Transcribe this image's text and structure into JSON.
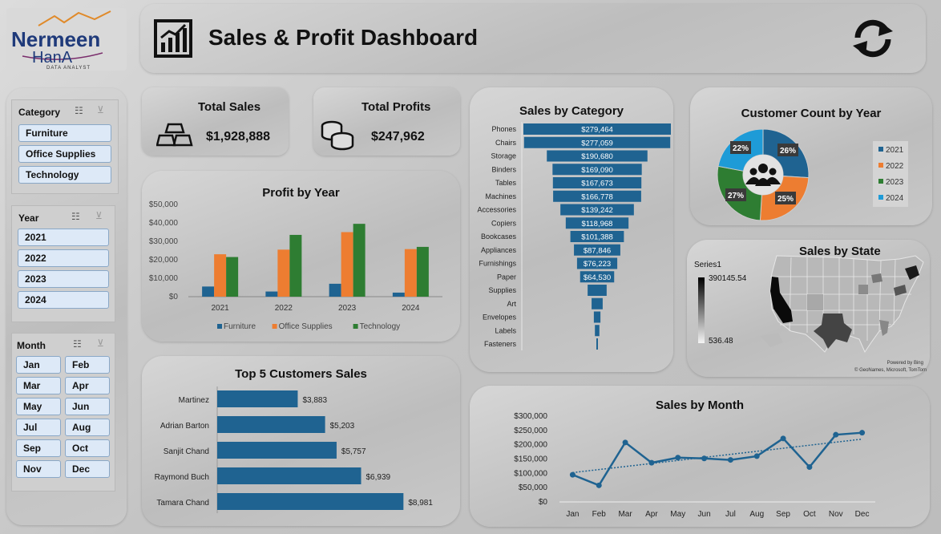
{
  "logo": {
    "name": "Nermeen",
    "name2": "HanA",
    "tagline": "DATA ANALYST"
  },
  "header": {
    "title": "Sales & Profit Dashboard"
  },
  "kpi": {
    "sales_label": "Total Sales",
    "sales_value": "$1,928,888",
    "profit_label": "Total Profits",
    "profit_value": "$247,962"
  },
  "slicers": {
    "category": {
      "title": "Category",
      "items": [
        "Furniture",
        "Office Supplies",
        "Technology"
      ]
    },
    "year": {
      "title": "Year",
      "items": [
        "2021",
        "2022",
        "2023",
        "2024"
      ]
    },
    "month": {
      "title": "Month",
      "items": [
        "Jan",
        "Feb",
        "Mar",
        "Apr",
        "May",
        "Jun",
        "Jul",
        "Aug",
        "Sep",
        "Oct",
        "Nov",
        "Dec"
      ]
    }
  },
  "colors": {
    "furniture": "#1f6391",
    "office": "#ed7d31",
    "technology": "#2e7d32",
    "y2024": "#1e9bd7"
  },
  "chart_data": [
    {
      "id": "profit_by_year",
      "type": "bar",
      "title": "Profit by Year",
      "categories": [
        "2021",
        "2022",
        "2023",
        "2024"
      ],
      "series": [
        {
          "name": "Furniture",
          "values": [
            5500,
            2800,
            7000,
            2200
          ]
        },
        {
          "name": "Office Supplies",
          "values": [
            23000,
            25500,
            35000,
            25800
          ]
        },
        {
          "name": "Technology",
          "values": [
            21500,
            33500,
            39500,
            27000
          ]
        }
      ],
      "ylim": [
        0,
        50000
      ],
      "yticks": [
        "$0",
        "$10,000",
        "$20,000",
        "$30,000",
        "$40,000",
        "$50,000"
      ],
      "legend": "bottom"
    },
    {
      "id": "sales_by_category",
      "type": "bar",
      "title": "Sales by Category",
      "categories": [
        "Phones",
        "Chairs",
        "Storage",
        "Binders",
        "Tables",
        "Machines",
        "Accessories",
        "Copiers",
        "Bookcases",
        "Appliances",
        "Furnishings",
        "Paper",
        "Supplies",
        "Art",
        "Envelopes",
        "Labels",
        "Fasteners"
      ],
      "values": [
        279464,
        277059,
        190680,
        169090,
        167673,
        166778,
        139242,
        118968,
        101388,
        87846,
        76223,
        64530,
        36000,
        21000,
        12500,
        8500,
        2900
      ],
      "labels": [
        "$279,464",
        "$277,059",
        "$190,680",
        "$169,090",
        "$167,673",
        "$166,778",
        "$139,242",
        "$118,968",
        "$101,388",
        "$87,846",
        "$76,223",
        "$64,530",
        "",
        "",
        "",
        "",
        ""
      ]
    },
    {
      "id": "customer_count_by_year",
      "type": "pie",
      "title": "Customer Count by Year",
      "categories": [
        "2021",
        "2022",
        "2023",
        "2024"
      ],
      "values": [
        26,
        25,
        27,
        22
      ],
      "labels": [
        "26%",
        "25%",
        "27%",
        "22%"
      ],
      "legend": "right"
    },
    {
      "id": "top5_customers",
      "type": "bar",
      "title": "Top 5 Customers Sales",
      "categories": [
        "Martinez",
        "Adrian Barton",
        "Sanjit Chand",
        "Raymond Buch",
        "Tamara Chand"
      ],
      "values": [
        3883,
        5203,
        5757,
        6939,
        8981
      ],
      "labels": [
        "$3,883",
        "$5,203",
        "$5,757",
        "$6,939",
        "$8,981"
      ]
    },
    {
      "id": "sales_by_month",
      "type": "line",
      "title": "Sales by Month",
      "categories": [
        "Jan",
        "Feb",
        "Mar",
        "Apr",
        "May",
        "Jun",
        "Jul",
        "Aug",
        "Sep",
        "Oct",
        "Nov",
        "Dec"
      ],
      "values": [
        95000,
        58000,
        208000,
        137000,
        155000,
        152000,
        147000,
        160000,
        222000,
        122000,
        235000,
        242000
      ],
      "ylim": [
        0,
        300000
      ],
      "yticks": [
        "$0",
        "$50,000",
        "$100,000",
        "$150,000",
        "$200,000",
        "$250,000",
        "$300,000"
      ],
      "trendline": true
    }
  ],
  "map": {
    "title": "Sales by State",
    "series": "Series1",
    "max": "390145.54",
    "min": "536.48",
    "credit1": "Powered by Bing",
    "credit2": "© GeoNames, Microsoft, TomTom"
  }
}
